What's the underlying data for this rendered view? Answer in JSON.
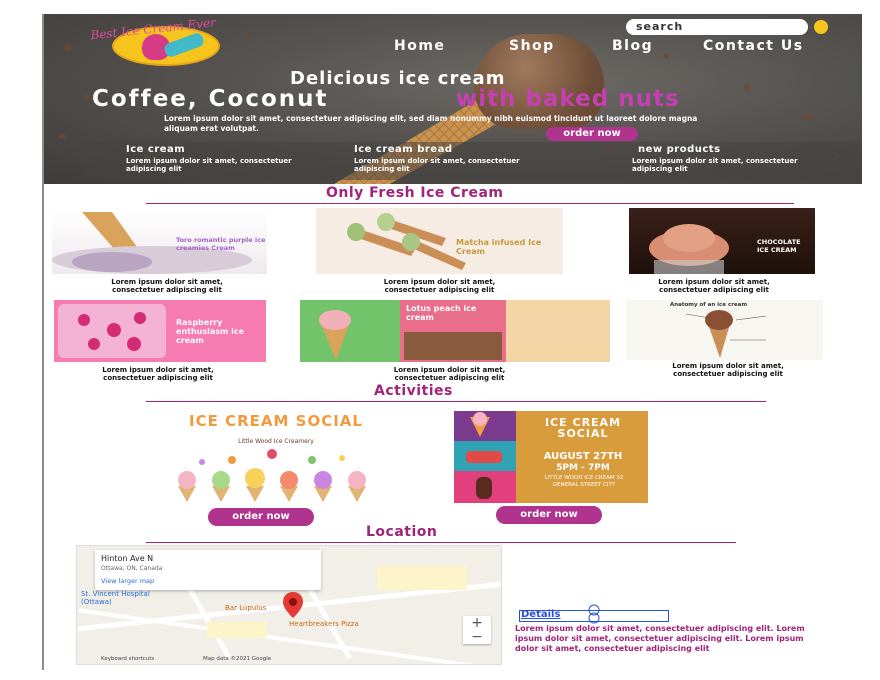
{
  "header": {
    "logo_text": "Best Ice Cream Ever",
    "search_placeholder": "search",
    "nav": [
      "Home",
      "Shop",
      "Blog",
      "Contact Us"
    ],
    "tagline": "Delicious ice cream",
    "headline_white": "Coffee, Coconut",
    "headline_pink": "with baked nuts",
    "lorem": "Lorem ipsum dolor sit amet, consectetuer adipiscing elit, sed diam nonummy nibh euismod tincidunt ut laoreet dolore magna aliquam erat volutpat.",
    "order_button": "order now",
    "features": [
      {
        "title": "Ice cream",
        "text": "Lorem ipsum dolor sit amet, consectetuer adipiscing elit"
      },
      {
        "title": "Ice cream bread",
        "text": "Lorem ipsum dolor sit amet, consectetuer adipiscing elit"
      },
      {
        "title": "new products",
        "text": "Lorem ipsum dolor sit amet, consectetuer adipiscing elit"
      }
    ]
  },
  "fresh": {
    "title": "Only Fresh Ice Cream",
    "cards": [
      {
        "image_text": "Toro romantic purple ice creamies Cream",
        "caption": "Lorem ipsum dolor sit amet, consectetuer adipiscing elit"
      },
      {
        "image_text": "Matcha infused Ice Cream",
        "caption": "Lorem ipsum dolor sit amet, consectetuer adipiscing elit"
      },
      {
        "image_text": "CHOCOLATE ICE CREAM",
        "caption": "Lorem ipsum dolor sit amet, consectetuer adipiscing elit"
      },
      {
        "image_text": "Raspberry enthusiasm ice cream",
        "caption": "Lorem ipsum dolor sit amet, consectetuer adipiscing elit"
      },
      {
        "image_text": "Lotus peach ice cream",
        "caption": "Lorem ipsum dolor sit amet, consectetuer adipiscing elit"
      },
      {
        "image_text": "Anatomy of an ice cream",
        "caption": "Lorem ipsum dolor sit amet, consectetuer adipiscing elit"
      }
    ]
  },
  "activities": {
    "title": "Activities",
    "left": {
      "title": "ICE CREAM SOCIAL",
      "subtitle": "Little Wood Ice Creamery",
      "button": "order now"
    },
    "right": {
      "title": "ICE CREAM SOCIAL",
      "date": "AUGUST 27TH",
      "time": "5PM - 7PM",
      "venue": "LITTLE WOOD ICE CREAM 32 GENERAL STREET CITY",
      "button": "order now"
    }
  },
  "location": {
    "title": "Location",
    "map_place": "Hinton Ave N",
    "map_address": "Ottawa, ON, Canada",
    "map_link": "View larger map",
    "map_labels": [
      "St. Vincent Hospital (Ottawa)",
      "Bar Lupulus",
      "Heartbreakers Pizza",
      "Keyboard shortcuts",
      "Map data ©2021 Google"
    ],
    "details_label": "Details",
    "details_text": "Lorem ipsum dolor sit amet, consectetuer adipiscing elit. Lorem ipsum dolor sit amet, consectetuer adipiscing elit. Lorem ipsum dolor sit amet, consectetuer adipiscing elit"
  },
  "colors": {
    "accent": "#a0237c",
    "button": "#b0338d",
    "yellow": "#f5c51e"
  }
}
